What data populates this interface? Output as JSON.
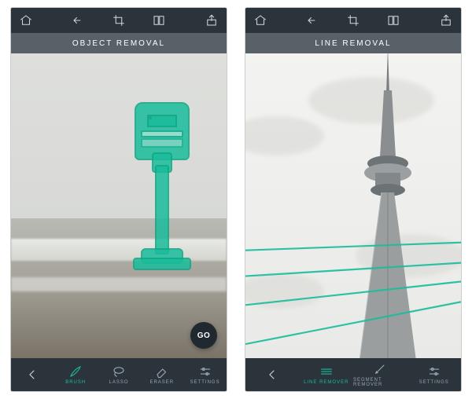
{
  "left": {
    "title": "OBJECT REMOVAL",
    "go_label": "GO",
    "tools": {
      "brush": "BRUSH",
      "lasso": "LASSO",
      "eraser": "ERASER",
      "settings": "SETTINGS"
    }
  },
  "right": {
    "title": "LINE REMOVAL",
    "tools": {
      "line_remover": "LINE REMOVER",
      "segment_remover": "SEGMENT REMOVER"
    }
  }
}
